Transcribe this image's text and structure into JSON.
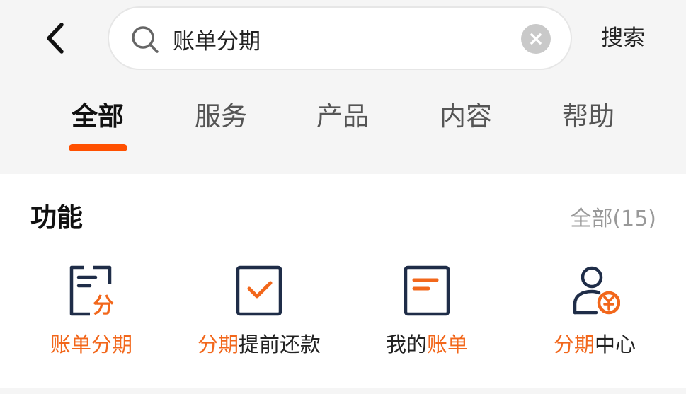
{
  "header": {
    "back_icon": "chevron-left-icon",
    "search": {
      "value": "账单分期",
      "icon": "search-icon",
      "clear_icon": "clear-icon"
    },
    "search_button_label": "搜索"
  },
  "tabs": [
    {
      "label": "全部",
      "active": true
    },
    {
      "label": "服务",
      "active": false
    },
    {
      "label": "产品",
      "active": false
    },
    {
      "label": "内容",
      "active": false
    },
    {
      "label": "帮助",
      "active": false
    }
  ],
  "functions_section": {
    "title": "功能",
    "view_all_label": "全部(15)",
    "items": [
      {
        "icon": "bill-installment-icon",
        "label_parts": [
          {
            "text": "账单分期",
            "highlight": true
          }
        ]
      },
      {
        "icon": "checkbox-check-icon",
        "label_parts": [
          {
            "text": "分期",
            "highlight": true
          },
          {
            "text": "提前还款",
            "highlight": false
          }
        ]
      },
      {
        "icon": "bill-document-icon",
        "label_parts": [
          {
            "text": "我的",
            "highlight": false
          },
          {
            "text": "账单",
            "highlight": true
          }
        ]
      },
      {
        "icon": "user-installment-center-icon",
        "label_parts": [
          {
            "text": "分期",
            "highlight": true
          },
          {
            "text": "中心",
            "highlight": false
          }
        ]
      }
    ]
  },
  "colors": {
    "accent": "#ff5000",
    "highlight_text": "#f2671b",
    "icon_dark": "#1f2d48",
    "icon_accent": "#f2671b"
  }
}
